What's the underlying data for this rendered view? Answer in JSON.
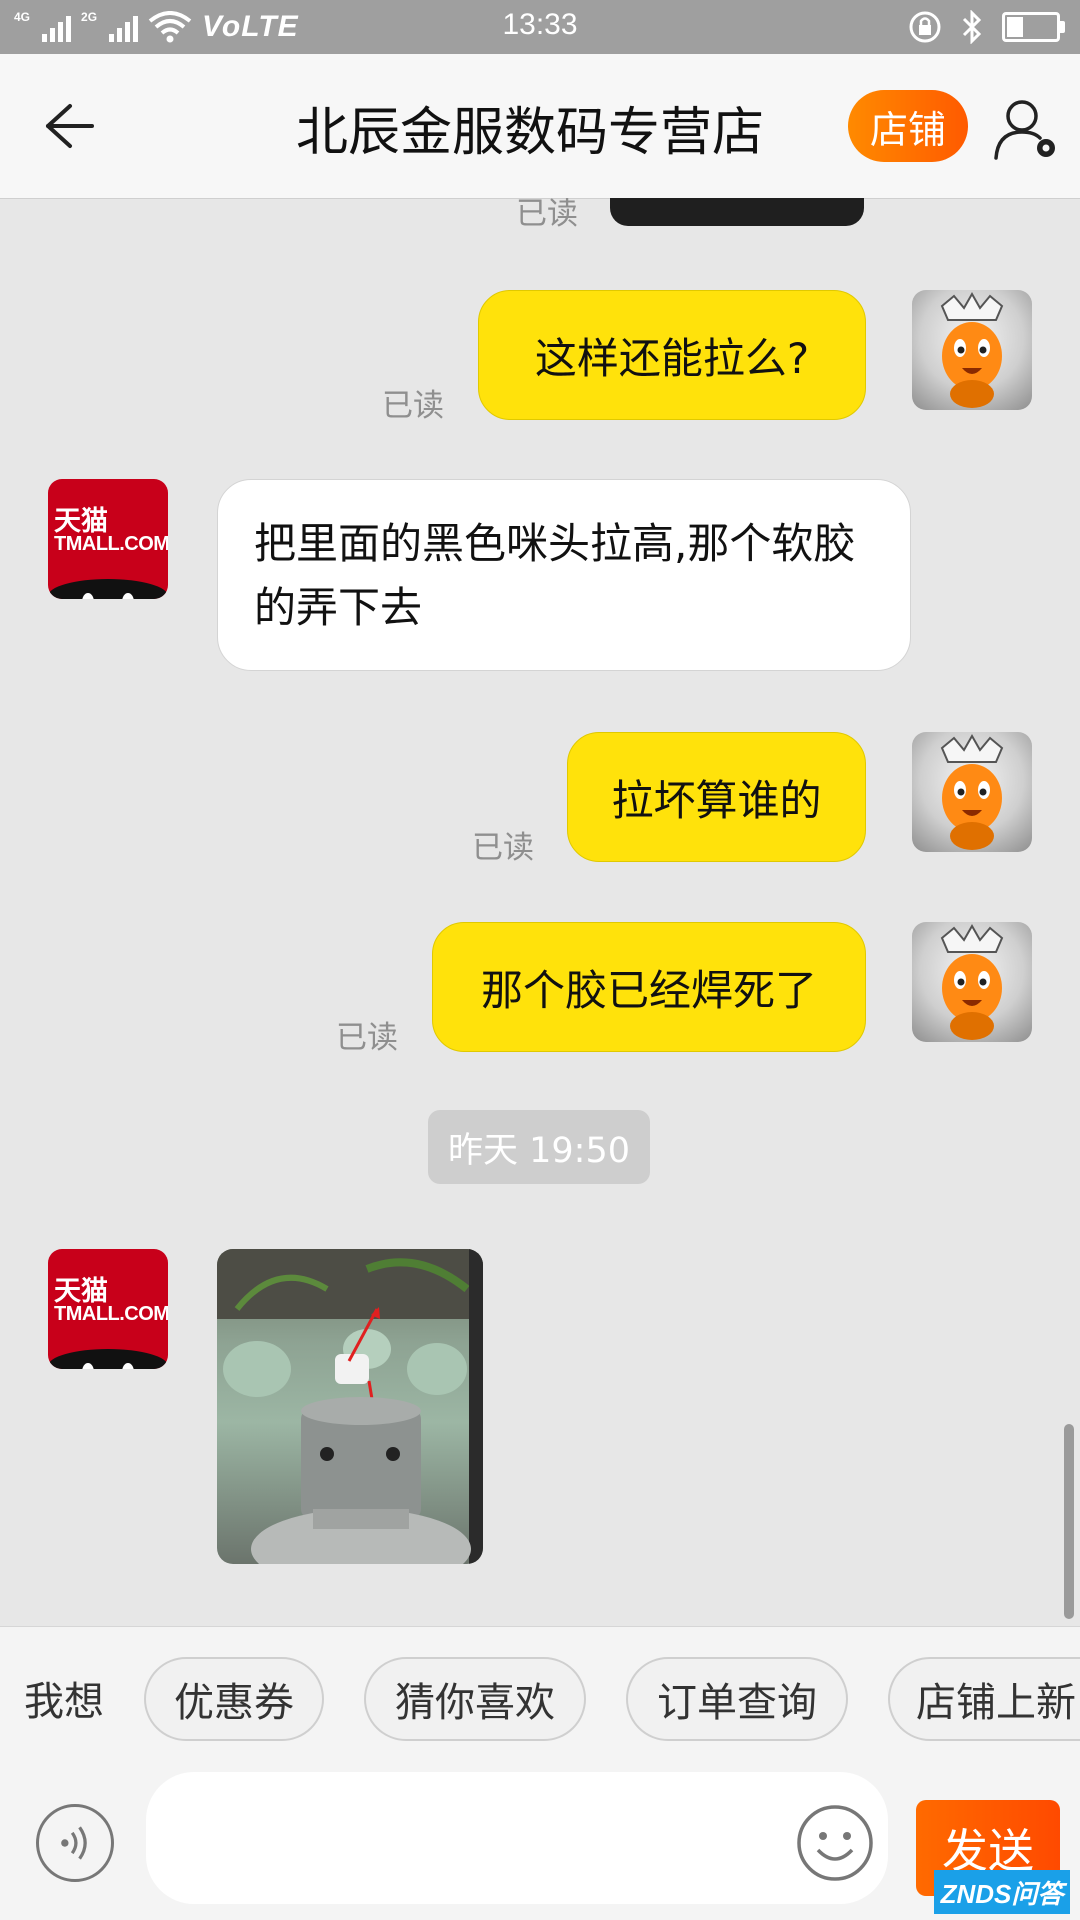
{
  "status_bar": {
    "network_1": "4G",
    "network_2": "2G",
    "volte": "VoLTE",
    "time": "13:33",
    "battery_level": 0.35
  },
  "header": {
    "title": "北辰金服数码专营店",
    "shop_label": "店铺"
  },
  "messages": [
    {
      "sender": "me",
      "type": "image",
      "read": "已读"
    },
    {
      "sender": "me",
      "type": "text",
      "text": "这样还能拉么?",
      "read": "已读"
    },
    {
      "sender": "store",
      "type": "text",
      "text": "把里面的黑色咪头拉高,那个软胶的弄下去"
    },
    {
      "sender": "me",
      "type": "text",
      "text": "拉坏算谁的",
      "read": "已读"
    },
    {
      "sender": "me",
      "type": "text",
      "text": "那个胶已经焊死了",
      "read": "已读"
    },
    {
      "type": "timestamp",
      "text": "昨天 19:50"
    },
    {
      "sender": "store",
      "type": "image"
    }
  ],
  "store_avatar": {
    "line1": "天猫",
    "line2": "TMALL.COM"
  },
  "quick_bar": {
    "label": "我想",
    "chips": [
      "优惠券",
      "猜你喜欢",
      "订单查询",
      "店铺上新"
    ]
  },
  "input_bar": {
    "placeholder": "",
    "send_label": "发送"
  },
  "watermark": "ZNDS问答",
  "colors": {
    "my_bubble": "#ffe20b",
    "accent_orange": "#ff6a00",
    "status_bar": "#9f9f9f"
  },
  "icons": [
    "back-arrow-icon",
    "user-settings-icon",
    "voice-icon",
    "emoji-icon"
  ]
}
